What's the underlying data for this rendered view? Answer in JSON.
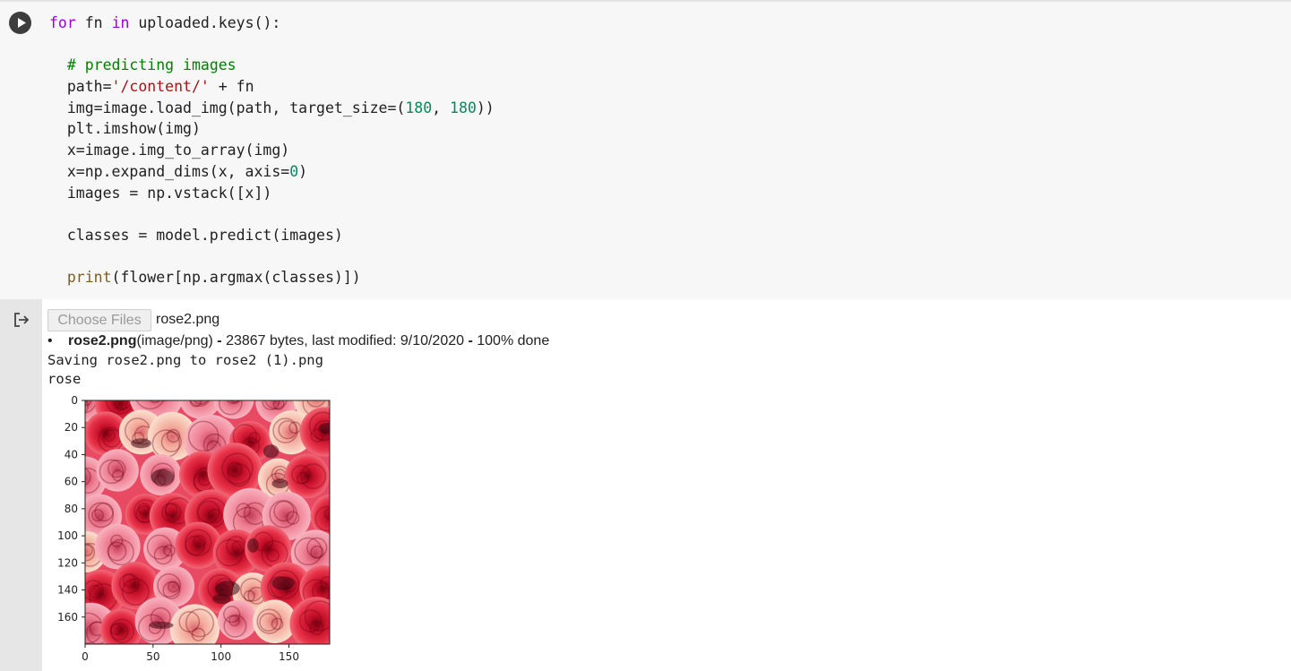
{
  "code_cell": {
    "lines": [
      [
        {
          "t": "for",
          "c": "kw"
        },
        {
          "t": " fn "
        },
        {
          "t": "in",
          "c": "kw"
        },
        {
          "t": " uploaded.keys():"
        }
      ],
      [],
      [
        {
          "t": "  "
        },
        {
          "t": "# predicting images",
          "c": "cm"
        }
      ],
      [
        {
          "t": "  path="
        },
        {
          "t": "'/content/'",
          "c": "st"
        },
        {
          "t": " + fn"
        }
      ],
      [
        {
          "t": "  img=image.load_img(path, target_size=("
        },
        {
          "t": "180",
          "c": "nm"
        },
        {
          "t": ", "
        },
        {
          "t": "180",
          "c": "nm"
        },
        {
          "t": "))"
        }
      ],
      [
        {
          "t": "  plt.imshow(img)"
        }
      ],
      [
        {
          "t": "  x=image.img_to_array(img)"
        }
      ],
      [
        {
          "t": "  x=np.expand_dims(x, axis="
        },
        {
          "t": "0",
          "c": "nm"
        },
        {
          "t": ")"
        }
      ],
      [
        {
          "t": "  images = np.vstack([x])"
        }
      ],
      [],
      [
        {
          "t": "  classes = model.predict(images)"
        }
      ],
      [],
      [
        {
          "t": "  "
        },
        {
          "t": "print",
          "c": "fn"
        },
        {
          "t": "(flower[np.argmax(classes)])"
        }
      ]
    ]
  },
  "output": {
    "choose_files_label": "Choose Files",
    "chosen_file": "rose2.png",
    "upload_bullet": "•",
    "upload_filename": "rose2.png",
    "upload_type": "(image/png)",
    "upload_sep1": " - ",
    "upload_size": "23867 bytes, last modified: 9/10/2020",
    "upload_sep2": " - ",
    "upload_progress": "100% done",
    "saving_line": "Saving rose2.png to rose2 (1).png",
    "prediction": "rose",
    "image_alt": "roses"
  },
  "chart_data": {
    "type": "image",
    "xticks": [
      0,
      50,
      100,
      150
    ],
    "yticks": [
      0,
      20,
      40,
      60,
      80,
      100,
      120,
      140,
      160
    ],
    "xlim": [
      0,
      180
    ],
    "ylim": [
      180,
      0
    ]
  },
  "colors": {
    "rose_red": "#d01c2c",
    "rose_pink": "#f07a8a",
    "rose_cream": "#f6c9b4"
  }
}
